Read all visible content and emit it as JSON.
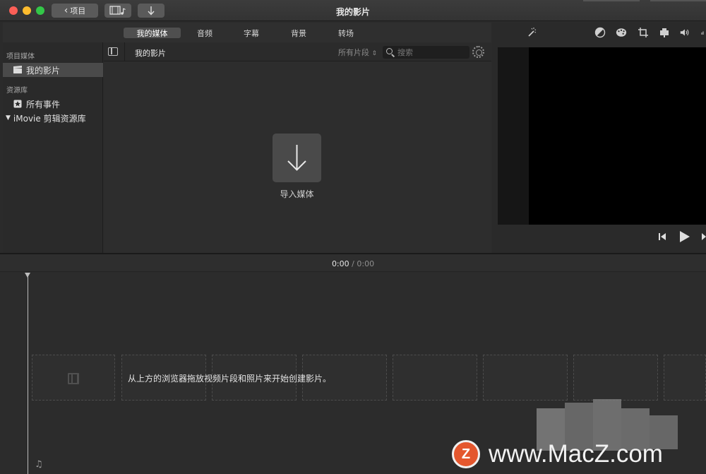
{
  "window": {
    "title": "我的影片",
    "back_label": "项目",
    "media_icon": "film-music-icon",
    "import_icon": "arrow-down-icon"
  },
  "tabs": [
    {
      "label": "我的媒体",
      "active": true
    },
    {
      "label": "音频",
      "active": false
    },
    {
      "label": "字幕",
      "active": false
    },
    {
      "label": "背景",
      "active": false
    },
    {
      "label": "转场",
      "active": false
    }
  ],
  "sidebar": {
    "section_project": "项目媒体",
    "project_item": "我的影片",
    "section_library": "资源库",
    "all_events": "所有事件",
    "library_name": "iMovie 剪辑资源库"
  },
  "browser": {
    "title": "我的影片",
    "filter": "所有片段",
    "search_placeholder": "搜索",
    "import_label": "导入媒体"
  },
  "viewer": {
    "tools": [
      "magic-wand-icon",
      "color-balance-icon",
      "palette-icon",
      "crop-icon",
      "camera-icon",
      "volume-icon"
    ]
  },
  "timecode": {
    "current": "0:00",
    "separator": "/",
    "total": "0:00"
  },
  "timeline": {
    "hint": "从上方的浏览器拖放视频片段和照片来开始创建影片。"
  },
  "watermark": {
    "logo_letter": "Z",
    "text": "www.MacZ.com"
  },
  "colors": {
    "background": "#2b2b2b",
    "selection": "#4a4a4a",
    "viewer_screen": "#000000",
    "watermark_logo": "#e4572e"
  }
}
